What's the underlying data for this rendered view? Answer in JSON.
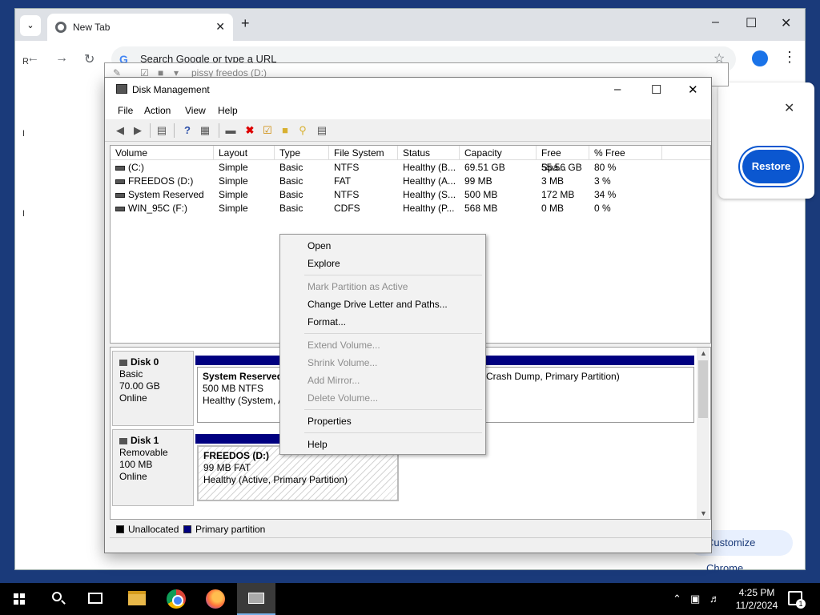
{
  "chrome": {
    "tab_title": "New Tab",
    "omnibox_placeholder": "Search Google or type a URL",
    "restore_label": "Restore",
    "customize_label": "Customize Chrome",
    "left_edge_letters": [
      "R",
      "I",
      "I"
    ]
  },
  "explorer": {
    "crumb": "pissy freedos (D:)"
  },
  "disk_mgmt": {
    "title": "Disk Management",
    "menus": [
      "File",
      "Action",
      "View",
      "Help"
    ],
    "columns": [
      "Volume",
      "Layout",
      "Type",
      "File System",
      "Status",
      "Capacity",
      "Free Spa...",
      "% Free"
    ],
    "volumes": [
      {
        "volume": "(C:)",
        "layout": "Simple",
        "type": "Basic",
        "fs": "NTFS",
        "status": "Healthy (B...",
        "capacity": "69.51 GB",
        "free": "55.56 GB",
        "pct": "80 %"
      },
      {
        "volume": "FREEDOS (D:)",
        "layout": "Simple",
        "type": "Basic",
        "fs": "FAT",
        "status": "Healthy (A...",
        "capacity": "99 MB",
        "free": "3 MB",
        "pct": "3 %"
      },
      {
        "volume": "System Reserved",
        "layout": "Simple",
        "type": "Basic",
        "fs": "NTFS",
        "status": "Healthy (S...",
        "capacity": "500 MB",
        "free": "172 MB",
        "pct": "34 %"
      },
      {
        "volume": "WIN_95C (F:)",
        "layout": "Simple",
        "type": "Basic",
        "fs": "CDFS",
        "status": "Healthy (P...",
        "capacity": "568 MB",
        "free": "0 MB",
        "pct": "0 %"
      }
    ],
    "disks": [
      {
        "name": "Disk 0",
        "kind": "Basic",
        "size": "70.00 GB",
        "state": "Online",
        "partitions": [
          {
            "name": "System Reserved",
            "line2": "500 MB NTFS",
            "line3": "Healthy (System, A"
          },
          {
            "name": "",
            "line2": "",
            "line3": "Crash Dump, Primary Partition)"
          }
        ]
      },
      {
        "name": "Disk 1",
        "kind": "Removable",
        "size": "100 MB",
        "state": "Online",
        "partitions": [
          {
            "name": "FREEDOS  (D:)",
            "line2": "99 MB FAT",
            "line3": "Healthy (Active, Primary Partition)"
          }
        ]
      }
    ],
    "legend": [
      {
        "label": "Unallocated",
        "color": "#000000"
      },
      {
        "label": "Primary partition",
        "color": "#000080"
      }
    ]
  },
  "context_menu": {
    "items": [
      {
        "label": "Open",
        "enabled": true
      },
      {
        "label": "Explore",
        "enabled": true
      },
      {
        "label": "Mark Partition as Active",
        "enabled": false
      },
      {
        "label": "Change Drive Letter and Paths...",
        "enabled": true
      },
      {
        "label": "Format...",
        "enabled": true
      },
      {
        "label": "Extend Volume...",
        "enabled": false
      },
      {
        "label": "Shrink Volume...",
        "enabled": false
      },
      {
        "label": "Add Mirror...",
        "enabled": false
      },
      {
        "label": "Delete Volume...",
        "enabled": false
      },
      {
        "label": "Properties",
        "enabled": true
      },
      {
        "label": "Help",
        "enabled": true
      }
    ]
  },
  "taskbar": {
    "time": "4:25 PM",
    "date": "11/2/2024",
    "notification_count": "1"
  }
}
